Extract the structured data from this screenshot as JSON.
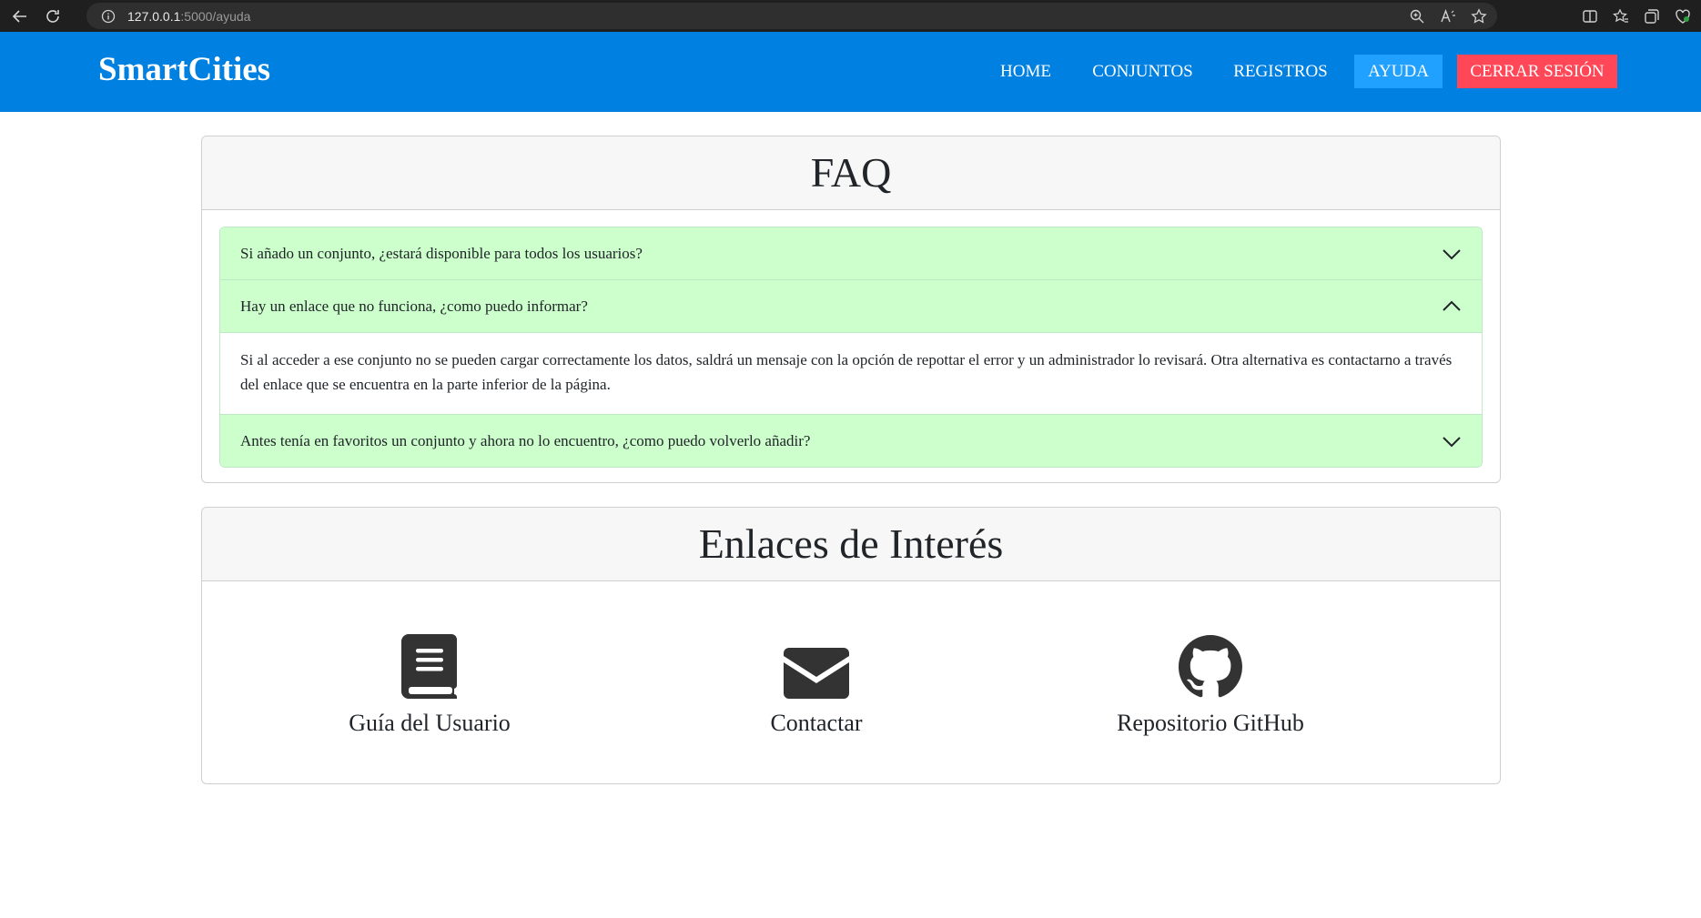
{
  "browser": {
    "url_host": "127.0.0.1",
    "url_path": ":5000/ayuda"
  },
  "navbar": {
    "brand": "SmartCities",
    "links": {
      "home": "HOME",
      "conjuntos": "CONJUNTOS",
      "registros": "REGISTROS",
      "ayuda": "AYUDA",
      "logout": "CERRAR SESIÓN"
    },
    "colors": {
      "bar": "#0080e0",
      "active": "#20a0ff",
      "logout": "#ff4757"
    }
  },
  "faq": {
    "title": "FAQ",
    "items": [
      {
        "question": "Si añado un conjunto, ¿estará disponible para todos los usuarios?",
        "expanded": false
      },
      {
        "question": "Hay un enlace que no funciona, ¿como puedo informar?",
        "expanded": true,
        "answer": "Si al acceder a ese conjunto no se pueden cargar correctamente los datos, saldrá un mensaje con la opción de repottar el error y un administrador lo revisará. Otra alternativa es contactarno a través del enlace que se encuentra en la parte inferior de la página."
      },
      {
        "question": "Antes tenía en favoritos un conjunto y ahora no lo encuentro, ¿como puedo volverlo añadir?",
        "expanded": false
      }
    ],
    "accordion_color": "#ccffcc"
  },
  "links": {
    "title": "Enlaces de Interés",
    "items": [
      {
        "label": "Guía del Usuario",
        "icon": "book-icon"
      },
      {
        "label": "Contactar",
        "icon": "envelope-icon"
      },
      {
        "label": "Repositorio GitHub",
        "icon": "github-icon"
      }
    ]
  }
}
